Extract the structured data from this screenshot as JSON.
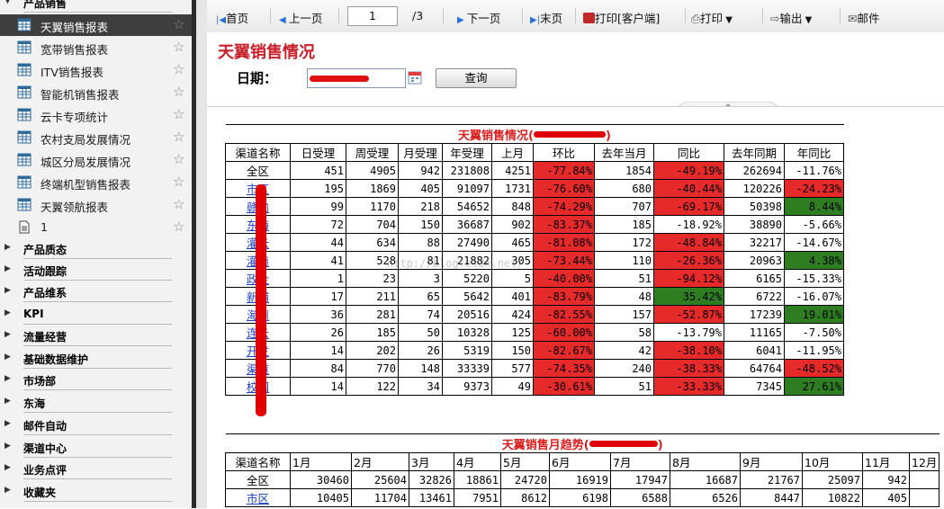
{
  "sidebar": {
    "top_section": "产品销售",
    "items": [
      {
        "label": "天翼销售报表",
        "active": true,
        "icon": "report-icon"
      },
      {
        "label": "宽带销售报表",
        "icon": "report-icon"
      },
      {
        "label": "ITV销售报表",
        "icon": "report-icon"
      },
      {
        "label": "智能机销售报表",
        "icon": "report-icon"
      },
      {
        "label": "云卡专项统计",
        "icon": "report-icon"
      },
      {
        "label": "农村支局发展情况",
        "icon": "report-icon"
      },
      {
        "label": "城区分局发展情况",
        "icon": "report-icon"
      },
      {
        "label": "终端机型销售报表",
        "icon": "report-icon"
      },
      {
        "label": "天翼领航报表",
        "icon": "report-icon"
      },
      {
        "label": "1",
        "icon": "document-icon"
      }
    ],
    "sections": [
      "产品质态",
      "活动跟踪",
      "产品维系",
      "KPI",
      "流量经营",
      "基础数据维护",
      "市场部",
      "东海",
      "邮件自动",
      "渠道中心",
      "业务点评",
      "收藏夹"
    ]
  },
  "toolbar": {
    "first": "首页",
    "prev": "上一页",
    "page": "1",
    "total": "/3",
    "next": "下一页",
    "last": "末页",
    "print_client": "打印[客户端]",
    "print": "打印",
    "export": "输出",
    "mail": "邮件"
  },
  "header": {
    "title": "天翼销售情况",
    "date_label": "日期：",
    "query_button": "查询"
  },
  "table1": {
    "title": "天翼销售情况",
    "columns": [
      "渠道名称",
      "日受理",
      "周受理",
      "月受理",
      "年受理",
      "上月",
      "环比",
      "去年当月",
      "同比",
      "去年同期",
      "年同比"
    ],
    "rows": [
      [
        "全区",
        "451",
        "4905",
        "942",
        "231808",
        "4251",
        "-77.84%",
        "1854",
        "-49.19%",
        "262694",
        "-11.76%"
      ],
      [
        "市区",
        "195",
        "1869",
        "405",
        "91097",
        "1731",
        "-76.60%",
        "680",
        "-40.44%",
        "120226",
        "-24.23%"
      ],
      [
        "赣榆",
        "99",
        "1170",
        "218",
        "54652",
        "848",
        "-74.29%",
        "707",
        "-69.17%",
        "50398",
        "8.44%"
      ],
      [
        "东海",
        "72",
        "704",
        "150",
        "36687",
        "902",
        "-83.37%",
        "185",
        "-18.92%",
        "38890",
        "-5.66%"
      ],
      [
        "灌云",
        "44",
        "634",
        "88",
        "27490",
        "465",
        "-81.08%",
        "172",
        "-48.84%",
        "32217",
        "-14.67%"
      ],
      [
        "灌南",
        "41",
        "528",
        "81",
        "21882",
        "305",
        "-73.44%",
        "110",
        "-26.36%",
        "20963",
        "4.38%"
      ],
      [
        "政企",
        "1",
        "23",
        "3",
        "5220",
        "5",
        "-40.00%",
        "51",
        "-94.12%",
        "6165",
        "-15.33%"
      ],
      [
        "新浦",
        "17",
        "211",
        "65",
        "5642",
        "401",
        "-83.79%",
        "48",
        "35.42%",
        "6722",
        "-16.07%"
      ],
      [
        "海州",
        "36",
        "281",
        "74",
        "20516",
        "424",
        "-82.55%",
        "157",
        "-52.87%",
        "17239",
        "19.01%"
      ],
      [
        "连云",
        "26",
        "185",
        "50",
        "10328",
        "125",
        "-60.00%",
        "58",
        "-13.79%",
        "11165",
        "-7.50%"
      ],
      [
        "开发",
        "14",
        "202",
        "26",
        "5319",
        "150",
        "-82.67%",
        "42",
        "-38.10%",
        "6041",
        "-11.95%"
      ],
      [
        "渠道",
        "84",
        "770",
        "148",
        "33339",
        "577",
        "-74.35%",
        "240",
        "-38.33%",
        "64764",
        "-48.52%"
      ],
      [
        "校园",
        "14",
        "122",
        "34",
        "9373",
        "49",
        "-30.61%",
        "51",
        "-33.33%",
        "7345",
        "27.61%"
      ]
    ]
  },
  "table2": {
    "title": "天翼销售月趋势",
    "columns": [
      "渠道名称",
      "1月",
      "2月",
      "3月",
      "4月",
      "5月",
      "6月",
      "7月",
      "8月",
      "9月",
      "10月",
      "11月",
      "12月"
    ],
    "rows": [
      [
        "全区",
        "30460",
        "25604",
        "32826",
        "18861",
        "24720",
        "16919",
        "17947",
        "16687",
        "21767",
        "25097",
        "942",
        ""
      ],
      [
        "市区",
        "10405",
        "11704",
        "13461",
        "7951",
        "8612",
        "6198",
        "6588",
        "6526",
        "8447",
        "10822",
        "405",
        ""
      ]
    ]
  },
  "watermark": "http://blog.csdn.net/",
  "colors": {
    "negative": "#e62a2a",
    "positive": "#2f7d21",
    "title_red": "#c8202a",
    "link": "#1a3fc7"
  }
}
